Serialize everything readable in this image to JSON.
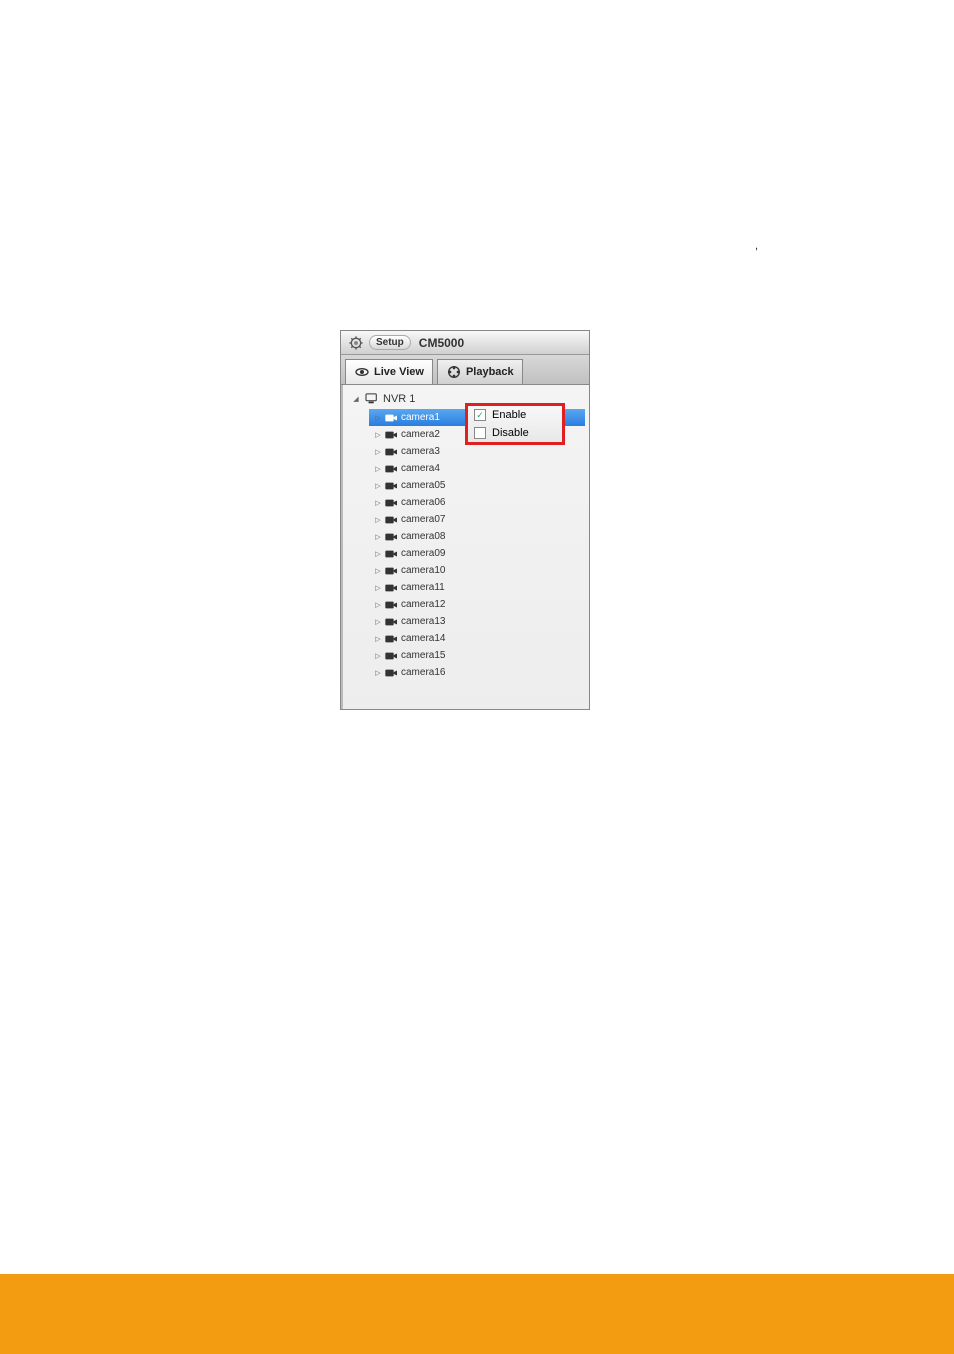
{
  "header": {
    "setup_label": "Setup",
    "app_title": "CM5000"
  },
  "tabs": {
    "live_view": "Live View",
    "playback": "Playback"
  },
  "tree": {
    "root_label": "NVR 1",
    "cameras": [
      {
        "label": "camera1",
        "selected": true
      },
      {
        "label": "camera2",
        "selected": false
      },
      {
        "label": "camera3",
        "selected": false
      },
      {
        "label": "camera4",
        "selected": false
      },
      {
        "label": "camera05",
        "selected": false
      },
      {
        "label": "camera06",
        "selected": false
      },
      {
        "label": "camera07",
        "selected": false
      },
      {
        "label": "camera08",
        "selected": false
      },
      {
        "label": "camera09",
        "selected": false
      },
      {
        "label": "camera10",
        "selected": false
      },
      {
        "label": "camera11",
        "selected": false
      },
      {
        "label": "camera12",
        "selected": false
      },
      {
        "label": "camera13",
        "selected": false
      },
      {
        "label": "camera14",
        "selected": false
      },
      {
        "label": "camera15",
        "selected": false
      },
      {
        "label": "camera16",
        "selected": false
      }
    ]
  },
  "context_menu": {
    "enable_label": "Enable",
    "disable_label": "Disable"
  },
  "glitch": {
    "comma": ","
  },
  "colors": {
    "highlight_border": "#e02020",
    "selection_bg": "#2a7de0",
    "footer_bg": "#f39c12"
  }
}
